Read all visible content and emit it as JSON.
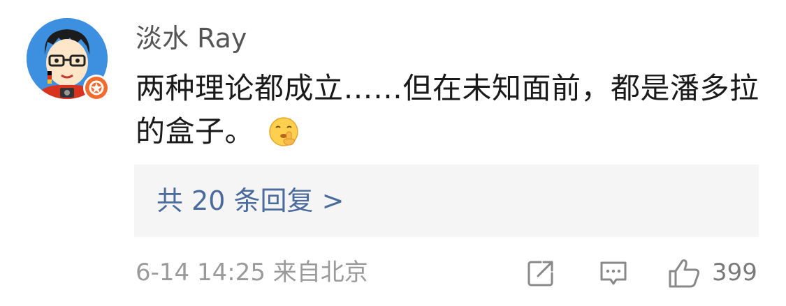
{
  "comment": {
    "username": "淡水 Ray",
    "text": "两种理论都成立……但在未知面前，都是潘多拉的盒子。",
    "emoji": "shushing-face-emoji",
    "replies_link": "共 20 条回复 >",
    "timestamp": "6-14 14:25",
    "location": "来自北京",
    "like_count": "399",
    "icons": {
      "share": "share-icon",
      "reply": "comment-icon",
      "like": "thumbs-up-icon",
      "verified": "verified-badge-icon"
    },
    "colors": {
      "link": "#4a6b9b",
      "meta": "#9a9a9a",
      "badge": "#f26b2e",
      "avatar_bg": "#3d8fe0"
    }
  }
}
